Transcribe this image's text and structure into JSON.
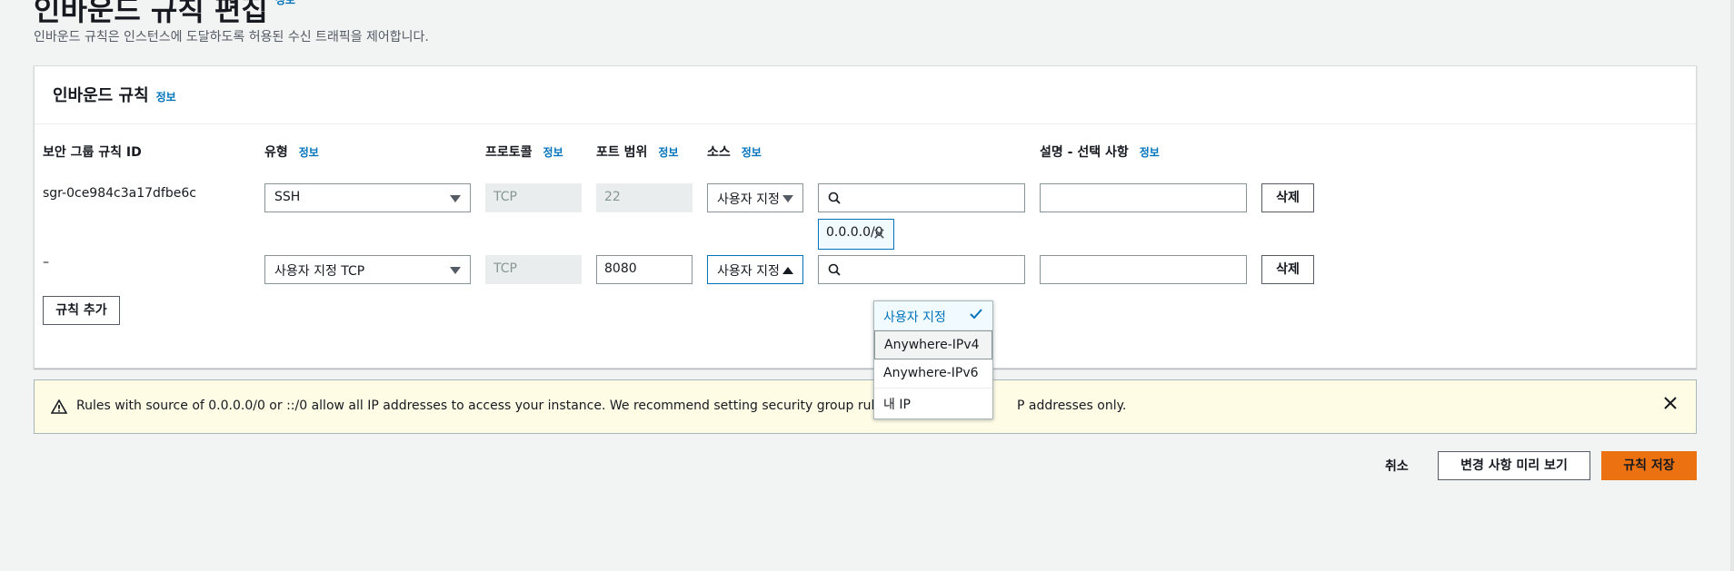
{
  "page": {
    "title": "인바운드 규칙 편집",
    "title_info": "정보",
    "description": "인바운드 규칙은 인스턴스에 도달하도록 허용된 수신 트래픽을 제어합니다."
  },
  "panel": {
    "title": "인바운드 규칙",
    "info": "정보",
    "columns": {
      "rule_id": "보안 그룹 규칙 ID",
      "type": "유형",
      "type_info": "정보",
      "protocol": "프로토콜",
      "protocol_info": "정보",
      "port_range": "포트 범위",
      "port_info": "정보",
      "source": "소스",
      "source_info": "정보",
      "description": "설명 - 선택 사항",
      "description_info": "정보"
    },
    "rows": [
      {
        "rule_id": "sgr-0ce984c3a17dfbe6c",
        "type": "SSH",
        "protocol": "TCP",
        "port": "22",
        "source": "사용자 지정",
        "search_placeholder": "",
        "token": "0.0.0.0/0",
        "description": "",
        "delete_label": "삭제"
      },
      {
        "rule_id": "–",
        "type": "사용자 지정 TCP",
        "protocol": "TCP",
        "port": "8080",
        "source": "사용자 지정",
        "search_placeholder": "",
        "description": "",
        "delete_label": "삭제"
      }
    ],
    "add_rule_label": "규칙 추가"
  },
  "dropdown": {
    "options": [
      "사용자 지정",
      "Anywhere-IPv4",
      "Anywhere-IPv6",
      "내 IP"
    ],
    "selected": "사용자 지정"
  },
  "alert": {
    "text_before": "Rules with source of 0.0.0.0/0 or ::/0 allow all IP addresses to access your instance. We recommend setting security group rules to allow a",
    "text_after": "P addresses only."
  },
  "footer": {
    "cancel_label": "취소",
    "preview_label": "변경 사항 미리 보기",
    "save_label": "규칙 저장"
  },
  "colors": {
    "accent": "#0073bb",
    "primary_button": "#ec7211",
    "warning_bg": "#fffce6"
  }
}
